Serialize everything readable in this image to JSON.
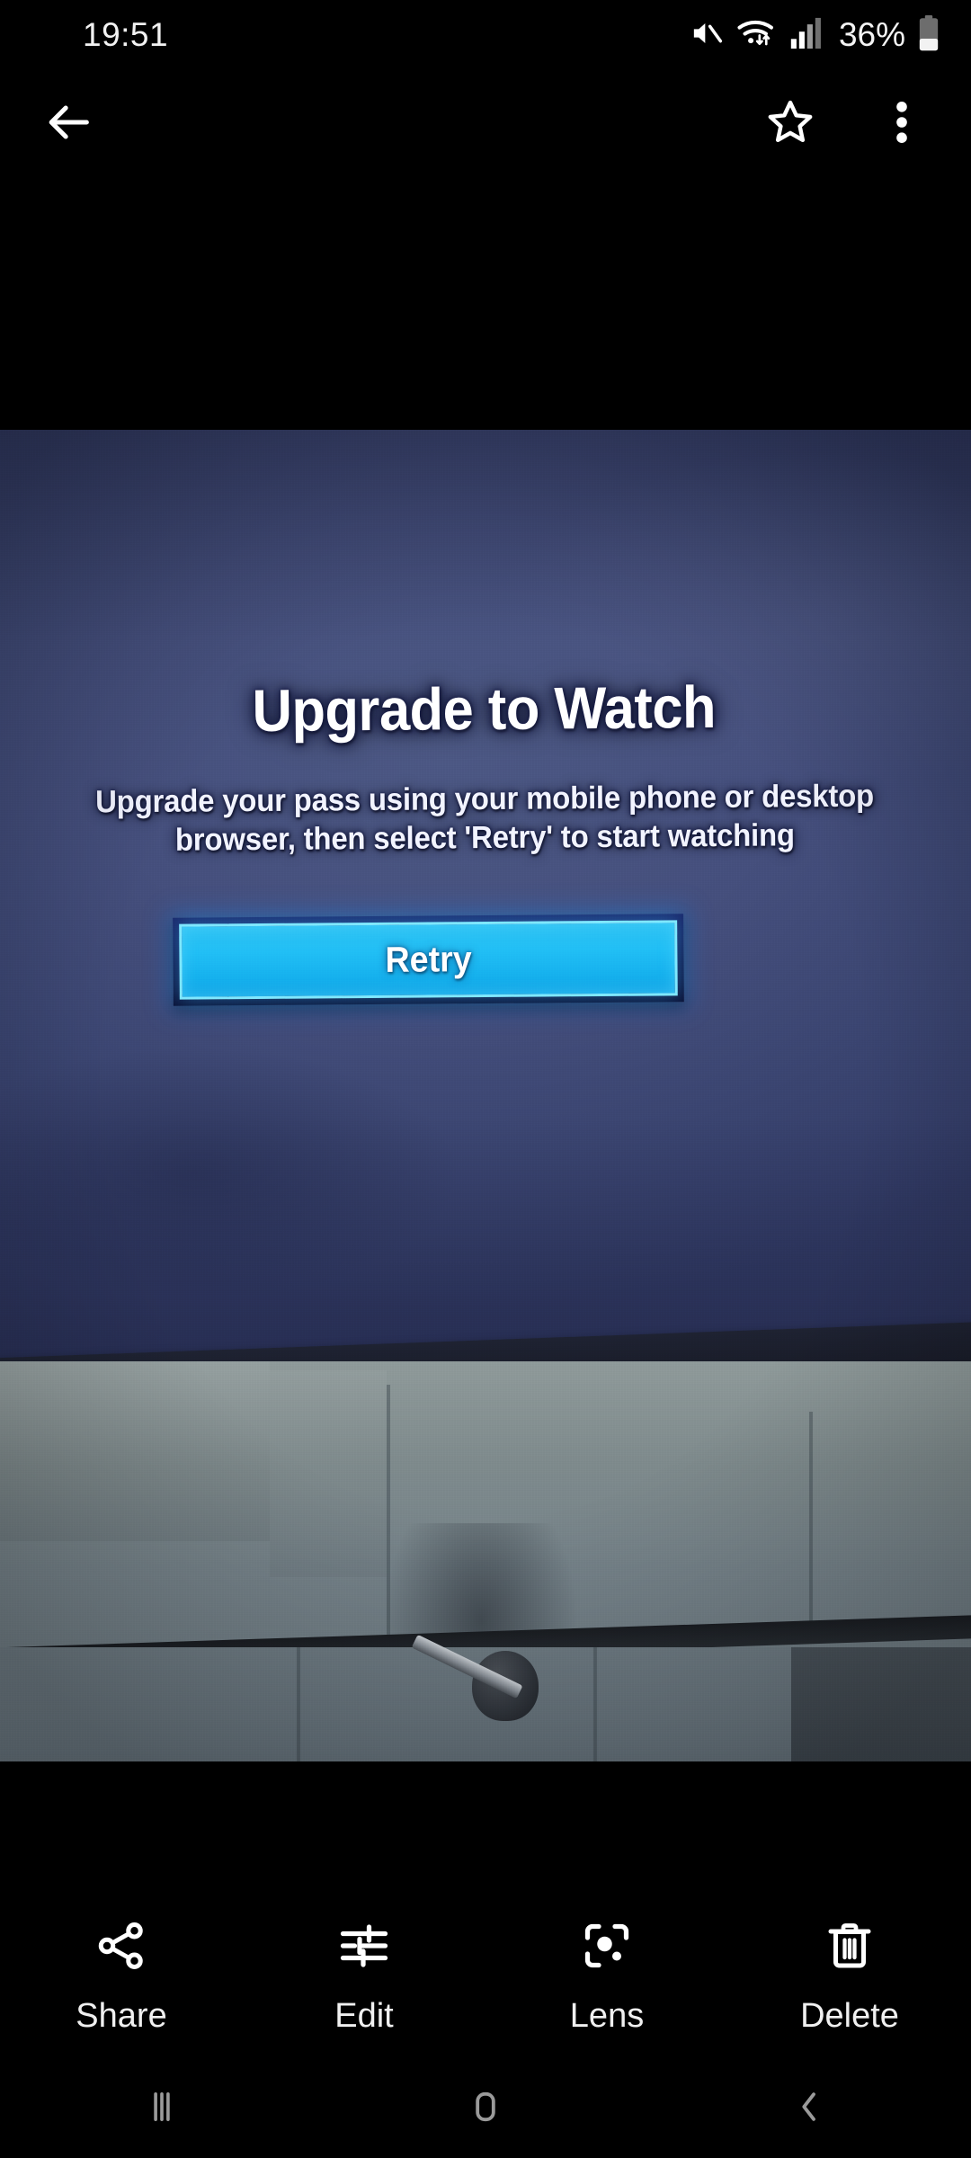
{
  "status_bar": {
    "time": "19:51",
    "battery_percent": "36%",
    "icons": [
      "mute-icon",
      "wifi-icon",
      "signal-icon",
      "battery-icon"
    ]
  },
  "app_bar": {
    "back_icon": "back-arrow-icon",
    "favorite_icon": "star-outline-icon",
    "overflow_icon": "more-vertical-icon"
  },
  "photo": {
    "tv_screen": {
      "title": "Upgrade to Watch",
      "subtitle": "Upgrade your pass using your mobile phone or desktop browser, then select 'Retry' to start watching",
      "button_label": "Retry",
      "background_color": "#414d7a",
      "button_color": "#1cbaf2",
      "button_border_color": "#7fe8ff"
    }
  },
  "toolbar": {
    "items": [
      {
        "label": "Share",
        "icon": "share-icon"
      },
      {
        "label": "Edit",
        "icon": "sliders-icon"
      },
      {
        "label": "Lens",
        "icon": "lens-icon"
      },
      {
        "label": "Delete",
        "icon": "trash-icon"
      }
    ]
  },
  "nav_bar": {
    "recents_icon": "recents-icon",
    "home_icon": "home-icon",
    "back_icon": "nav-back-icon"
  }
}
